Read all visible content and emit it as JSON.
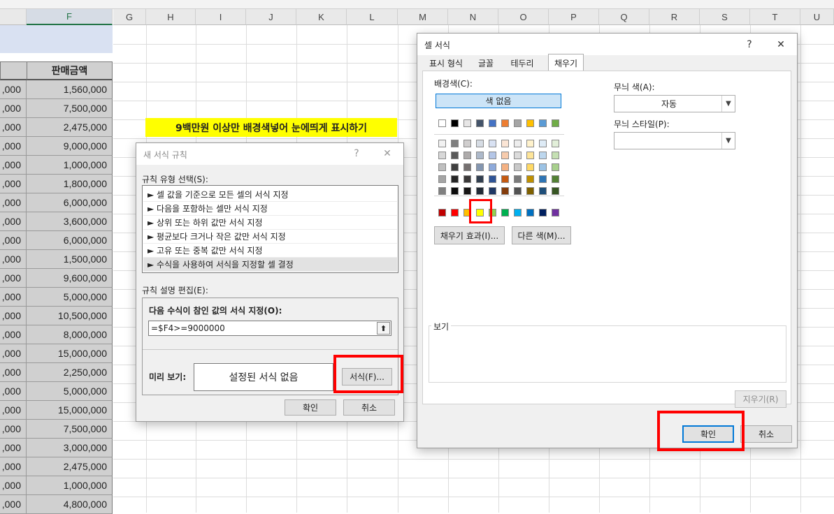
{
  "columns": [
    "F",
    "G",
    "H",
    "I",
    "J",
    "K",
    "L",
    "M",
    "N",
    "O",
    "P",
    "Q",
    "R",
    "S",
    "T",
    "U"
  ],
  "sheet": {
    "header_f": "판매금액",
    "rows": [
      {
        "e": ",000",
        "f": "1,560,000"
      },
      {
        "e": ",000",
        "f": "7,500,000"
      },
      {
        "e": ",000",
        "f": "2,475,000"
      },
      {
        "e": ",000",
        "f": "9,000,000"
      },
      {
        "e": ",000",
        "f": "1,000,000"
      },
      {
        "e": ",000",
        "f": "1,800,000"
      },
      {
        "e": ",000",
        "f": "6,000,000"
      },
      {
        "e": ",000",
        "f": "3,600,000"
      },
      {
        "e": ",000",
        "f": "6,000,000"
      },
      {
        "e": ",000",
        "f": "1,500,000"
      },
      {
        "e": ",000",
        "f": "9,600,000"
      },
      {
        "e": ",000",
        "f": "5,000,000"
      },
      {
        "e": ",000",
        "f": "10,500,000"
      },
      {
        "e": ",000",
        "f": "8,000,000"
      },
      {
        "e": ",000",
        "f": "15,000,000"
      },
      {
        "e": ",000",
        "f": "2,250,000"
      },
      {
        "e": ",000",
        "f": "5,000,000"
      },
      {
        "e": ",000",
        "f": "15,000,000"
      },
      {
        "e": ",000",
        "f": "7,500,000"
      },
      {
        "e": ",000",
        "f": "3,000,000"
      },
      {
        "e": ",000",
        "f": "2,475,000"
      },
      {
        "e": ",000",
        "f": "1,000,000"
      },
      {
        "e": ",000",
        "f": "4,800,000"
      }
    ],
    "note": "9백만원 이상만 배경색넣어 눈에띄게 표시하기"
  },
  "rule_dialog": {
    "title": "새 서식 규칙",
    "help": "?",
    "close": "✕",
    "rule_type_label": "규칙 유형 선택(S):",
    "rule_types": [
      "► 셀 값을 기준으로 모든 셀의 서식 지정",
      "► 다음을 포함하는 셀만 서식 지정",
      "► 상위 또는 하위 값만 서식 지정",
      "► 평균보다 크거나 작은 값만 서식 지정",
      "► 고유 또는 중복 값만 서식 지정",
      "► 수식을 사용하여 서식을 지정할 셀 결정"
    ],
    "desc_label": "규칙 설명 편집(E):",
    "formula_label": "다음 수식이 참인 값의 서식 지정(O):",
    "formula_value": "=$F4>=9000000",
    "preview_label": "미리 보기:",
    "preview_text": "설정된 서식 없음",
    "format_button": "서식(F)...",
    "ok": "확인",
    "cancel": "취소"
  },
  "format_dialog": {
    "title": "셀 서식",
    "help": "?",
    "close": "✕",
    "tabs": [
      "표시 형식",
      "글꼴",
      "테두리",
      "채우기"
    ],
    "bg_label": "배경색(C):",
    "no_color": "색 없음",
    "theme_top": [
      "#ffffff",
      "#000000",
      "#e7e6e6",
      "#44546a",
      "#4472c4",
      "#ed7d31",
      "#a5a5a5",
      "#ffc000",
      "#5b9bd5",
      "#70ad47"
    ],
    "theme_shades": [
      [
        "#f2f2f2",
        "#7f7f7f",
        "#d0cece",
        "#d6dce4",
        "#d9e2f3",
        "#fbe5d5",
        "#ededed",
        "#fff2cc",
        "#deebf6",
        "#e2efd9"
      ],
      [
        "#d8d8d8",
        "#595959",
        "#aeabab",
        "#adb9ca",
        "#b4c6e7",
        "#f7cbac",
        "#dbdbdb",
        "#fee599",
        "#bdd7ee",
        "#c5e0b3"
      ],
      [
        "#bfbfbf",
        "#3f3f3f",
        "#757070",
        "#8496b0",
        "#8eaadb",
        "#f4b183",
        "#c9c9c9",
        "#ffd965",
        "#9cc3e5",
        "#a8d08d"
      ],
      [
        "#a5a5a5",
        "#262626",
        "#3a3838",
        "#323f4f",
        "#2f5496",
        "#c55a11",
        "#7b7b7b",
        "#bf9000",
        "#2e75b5",
        "#538135"
      ],
      [
        "#7f7f7f",
        "#0c0c0c",
        "#171616",
        "#222a35",
        "#1f3864",
        "#833c0b",
        "#525252",
        "#7f6000",
        "#1e4e79",
        "#375623"
      ]
    ],
    "standard": [
      "#c00000",
      "#ff0000",
      "#ffc000",
      "#ffff00",
      "#92d050",
      "#00b050",
      "#00b0f0",
      "#0070c0",
      "#002060",
      "#7030a0"
    ],
    "fill_effects": "채우기 효과(I)...",
    "more_colors": "다른 색(M)...",
    "pattern_color_label": "무늬 색(A):",
    "pattern_color_value": "자동",
    "pattern_style_label": "무늬 스타일(P):",
    "pattern_style_value": "",
    "sample_label": "보기",
    "clear": "지우기(R)",
    "ok": "확인",
    "cancel": "취소"
  }
}
